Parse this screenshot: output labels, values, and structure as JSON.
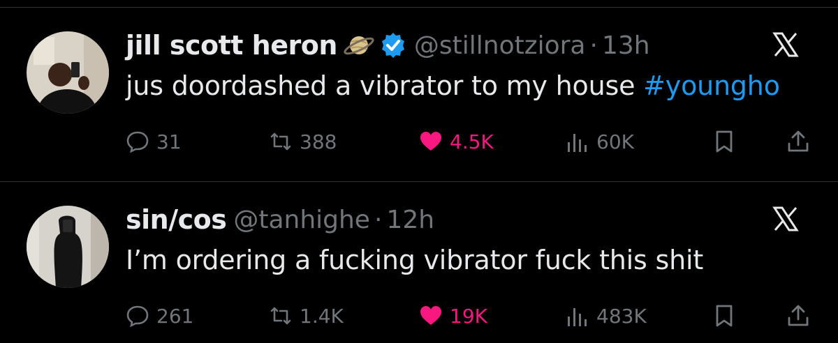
{
  "tweets": [
    {
      "display_name": "jill scott heron",
      "badge_emoji": "planet-emoji-icon",
      "verified": true,
      "handle": "@stillnotziora",
      "separator": "·",
      "time": "13h",
      "text": "jus doordashed a vibrator to my house ",
      "hashtag": "#youngho",
      "replies": "31",
      "retweets": "388",
      "likes": "4.5K",
      "views": "60K"
    },
    {
      "display_name": "sin/cos",
      "handle": "@tanhighe",
      "separator": "·",
      "time": "12h",
      "text": "I’m ordering a fucking vibrator fuck this shit",
      "replies": "261",
      "retweets": "1.4K",
      "likes": "19K",
      "views": "483K"
    }
  ],
  "colors": {
    "background": "#000000",
    "text": "#e7e9ea",
    "muted": "#71767b",
    "hashtag": "#1d9bf0",
    "like": "#f91880",
    "verified": "#1d9bf0"
  }
}
